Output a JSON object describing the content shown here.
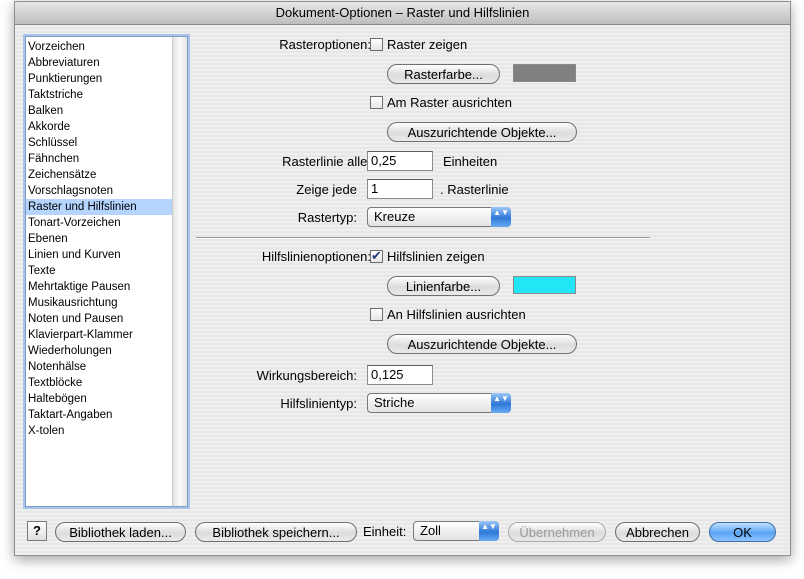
{
  "window": {
    "title": "Dokument-Optionen – Raster und Hilfslinien"
  },
  "sidebar": {
    "items": [
      {
        "label": "Vorzeichen"
      },
      {
        "label": "Abbreviaturen"
      },
      {
        "label": "Punktierungen"
      },
      {
        "label": "Taktstriche"
      },
      {
        "label": "Balken"
      },
      {
        "label": "Akkorde"
      },
      {
        "label": "Schlüssel"
      },
      {
        "label": "Fähnchen"
      },
      {
        "label": "Zeichensätze"
      },
      {
        "label": "Vorschlagsnoten"
      },
      {
        "label": "Raster und Hilfslinien",
        "selected": true
      },
      {
        "label": "Tonart-Vorzeichen"
      },
      {
        "label": "Ebenen"
      },
      {
        "label": "Linien und Kurven"
      },
      {
        "label": "Texte"
      },
      {
        "label": "Mehrtaktige Pausen"
      },
      {
        "label": "Musikausrichtung"
      },
      {
        "label": "Noten und Pausen"
      },
      {
        "label": "Klavierpart-Klammer"
      },
      {
        "label": "Wiederholungen"
      },
      {
        "label": "Notenhälse"
      },
      {
        "label": "Textblöcke"
      },
      {
        "label": "Haltebögen"
      },
      {
        "label": "Taktart-Angaben"
      },
      {
        "label": "X-tolen"
      }
    ]
  },
  "raster": {
    "section_label": "Rasteroptionen:",
    "show_grid_label": "Raster zeigen",
    "show_grid_checked": false,
    "grid_color_button": "Rasterfarbe...",
    "grid_color": "#808080",
    "snap_label": "Am Raster ausrichten",
    "snap_checked": false,
    "objects_button": "Auszurichtende Objekte...",
    "line_every_label": "Rasterlinie alle:",
    "line_every_value": "0,25",
    "units_label": "Einheiten",
    "show_every_label": "Zeige jede",
    "show_every_value": "1",
    "show_every_suffix": ". Rasterlinie",
    "type_label": "Rastertyp:",
    "type_value": "Kreuze"
  },
  "guides": {
    "section_label": "Hilfslinienoptionen:",
    "show_label": "Hilfslinien zeigen",
    "show_checked": true,
    "color_button": "Linienfarbe...",
    "color": "#22e5f5",
    "snap_label": "An Hilfslinien ausrichten",
    "snap_checked": false,
    "objects_button": "Auszurichtende Objekte...",
    "range_label": "Wirkungsbereich:",
    "range_value": "0,125",
    "type_label": "Hilfslinientyp:",
    "type_value": "Striche"
  },
  "footer": {
    "help_label": "?",
    "load_button": "Bibliothek laden...",
    "save_button": "Bibliothek speichern...",
    "unit_label": "Einheit:",
    "unit_value": "Zoll",
    "apply_button": "Übernehmen",
    "cancel_button": "Abbrechen",
    "ok_button": "OK"
  },
  "icons": {
    "check_mark": "✔",
    "select_arrows": "▲▼"
  }
}
